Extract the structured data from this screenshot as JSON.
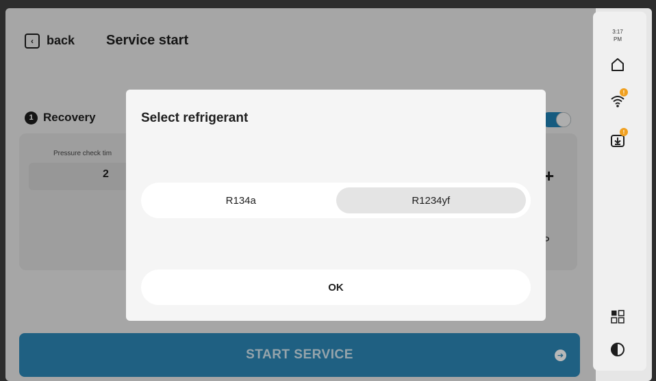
{
  "header": {
    "back_label": "back",
    "title": "Service start"
  },
  "step": {
    "number": "1",
    "label": "Recovery"
  },
  "pressure_check": {
    "caption": "Pressure check tim",
    "value": "2",
    "increment_label": "+",
    "unit_partial": "P"
  },
  "toggle": {
    "state": "on",
    "color": "#1f7fb0"
  },
  "start_button": {
    "label": "START SERVICE"
  },
  "rail": {
    "time": "3:17",
    "meridiem": "PM",
    "icons": [
      "home-icon",
      "wifi-icon",
      "download-icon",
      "grid-icon",
      "contrast-icon"
    ],
    "wifi_badge": "!",
    "download_badge": "!",
    "badge_color": "#f0a020"
  },
  "dialog": {
    "title": "Select refrigerant",
    "options": [
      "R134a",
      "R1234yf"
    ],
    "selected_option": "R1234yf",
    "ok_label": "OK"
  },
  "colors": {
    "accent": "#2b85b5",
    "background": "#e6e6e6",
    "dialog": "#f5f5f5"
  }
}
